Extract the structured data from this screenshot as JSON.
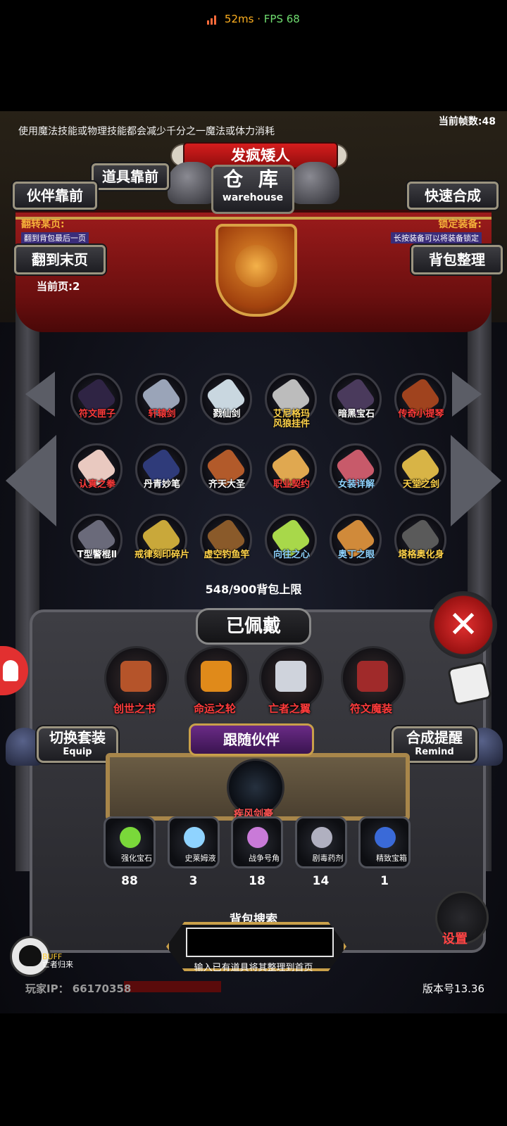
{
  "status_bar": {
    "ping": "52ms",
    "separator": "·",
    "fps": "FPS 68"
  },
  "top_hint": "使用魔法技能或物理技能都会减少千分之一魔法或体力消耗",
  "frames_label": "当前帧数:48",
  "title": "发疯矮人",
  "warehouse": {
    "cn": "仓 库",
    "en": "warehouse"
  },
  "buttons": {
    "items_first": "道具靠前",
    "partners_first": "伙伴靠前",
    "quick_merge": "快速合成",
    "flip_last": "翻到末页",
    "bag_sort": "背包整理"
  },
  "flip_page": {
    "label": "翻转某页:",
    "sub": "翻到背包最后一页"
  },
  "lock_equip": {
    "label": "锁定装备:",
    "sub": "长按装备可以将装备锁定"
  },
  "current_page": "当前页:2",
  "items": [
    {
      "name": "符文匣子",
      "color": "#ff3b3b",
      "icon": "#2f2444"
    },
    {
      "name": "轩辕剑",
      "color": "#ff3b3b",
      "icon": "#9aa4b8"
    },
    {
      "name": "戮仙剑",
      "color": "#ffffff",
      "icon": "#c9d7e0"
    },
    {
      "name": "艾尼格玛\n风狼挂件",
      "color": "#ffd34a",
      "icon": "#bcbcbc"
    },
    {
      "name": "暗黑宝石",
      "color": "#ffffff",
      "icon": "#4a3a5c"
    },
    {
      "name": "传奇小提琴",
      "color": "#ff3b3b",
      "icon": "#a0431e"
    },
    {
      "name": "认真之拳",
      "color": "#ff3b3b",
      "icon": "#e9c9c0"
    },
    {
      "name": "丹青妙笔",
      "color": "#ffffff",
      "icon": "#2f3b7a"
    },
    {
      "name": "齐天大圣",
      "color": "#ffffff",
      "icon": "#b25a2a"
    },
    {
      "name": "职业契约",
      "color": "#ff3b3b",
      "icon": "#e0a850"
    },
    {
      "name": "女装详解",
      "color": "#8fd3ff",
      "icon": "#c85a6a"
    },
    {
      "name": "天堂之剑",
      "color": "#ffd34a",
      "icon": "#d8b446"
    },
    {
      "name": "T型警棍Ⅱ",
      "color": "#ffffff",
      "icon": "#6a6a7a"
    },
    {
      "name": "戒律刻印碎片",
      "color": "#ffd34a",
      "icon": "#c9a83a"
    },
    {
      "name": "虚空钓鱼竿",
      "color": "#ffd34a",
      "icon": "#8a5a2a"
    },
    {
      "name": "向往之心",
      "color": "#8fd3ff",
      "icon": "#a8d84a"
    },
    {
      "name": "奥丁之眼",
      "color": "#8fd3ff",
      "icon": "#d08a3a"
    },
    {
      "name": "塔格奥化身",
      "color": "#ffd34a",
      "icon": "#5a5a5a"
    }
  ],
  "bag_capacity": "548/900背包上限",
  "equipped": {
    "title": "已佩戴",
    "items": [
      {
        "name": "创世之书",
        "icon": "#b5542a"
      },
      {
        "name": "命运之轮",
        "icon": "#e08a1a"
      },
      {
        "name": "亡者之翼",
        "icon": "#cfd3dc"
      },
      {
        "name": "符文魔装",
        "icon": "#a02a2a"
      }
    ]
  },
  "switch_set": {
    "cn": "切换套装",
    "en": "Equip"
  },
  "merge_remind": {
    "cn": "合成提醒",
    "en": "Remind"
  },
  "follow": {
    "title": "跟随伙伴",
    "pet_name": "疾风剑豪"
  },
  "resources": [
    {
      "label": "强化宝石",
      "count": "88",
      "icon": "#7ad83a"
    },
    {
      "label": "史莱姆液",
      "count": "3",
      "icon": "#8fd3ff"
    },
    {
      "label": "战争号角",
      "count": "18",
      "icon": "#c97ad8"
    },
    {
      "label": "剧毒药剂",
      "count": "14",
      "icon": "#b0b0c0"
    },
    {
      "label": "精致宝箱",
      "count": "1",
      "icon": "#3a6ad8"
    }
  ],
  "search": {
    "title": "背包搜索",
    "placeholder": "",
    "hint": "输入已有道具将其整理到首页"
  },
  "buff": {
    "label": "BUFF",
    "sub": "亡者归来"
  },
  "settings_label": "设置",
  "player_ip": "玩家IP： 66170358",
  "version": "版本号13.36"
}
